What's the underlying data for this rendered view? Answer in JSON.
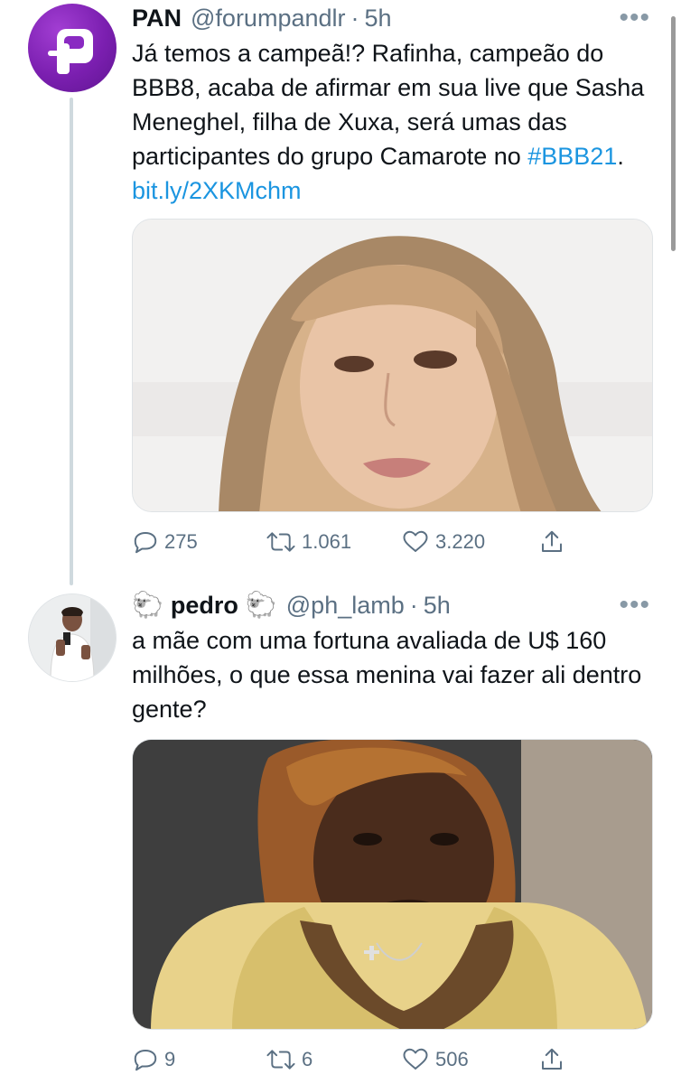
{
  "tweets": [
    {
      "name": "PAN",
      "handle": "@forumpandlr",
      "dot": "·",
      "time": "5h",
      "text_parts": {
        "main": "Já temos a campeã!? Rafinha, campeão do BBB8, acaba de afirmar em sua live que Sasha Meneghel,  filha de Xuxa, será umas das participantes do grupo Camarote no ",
        "hashtag": "#BBB21",
        "after_hashtag": ".  ",
        "link": "bit.ly/2XKMchm"
      },
      "actions": {
        "replies": "275",
        "retweets": "1.061",
        "likes": "3.220"
      }
    },
    {
      "name": "pedro",
      "name_emoji": "🐑",
      "handle": "@ph_lamb",
      "dot": "·",
      "time": "5h",
      "text": "a mãe com uma fortuna avaliada de U$ 160 milhões, o que essa menina vai fazer ali dentro gente?",
      "actions": {
        "replies": "9",
        "retweets": "6",
        "likes": "506"
      }
    }
  ],
  "more_label": "•••",
  "colors": {
    "link": "#1b95e0",
    "muted": "#5b7083",
    "avatar_pan": "#7b1fb0"
  },
  "icons": [
    "pan-logo-icon",
    "more-icon",
    "reply-icon",
    "retweet-icon",
    "like-icon",
    "share-icon",
    "sheep-emoji-icon"
  ]
}
